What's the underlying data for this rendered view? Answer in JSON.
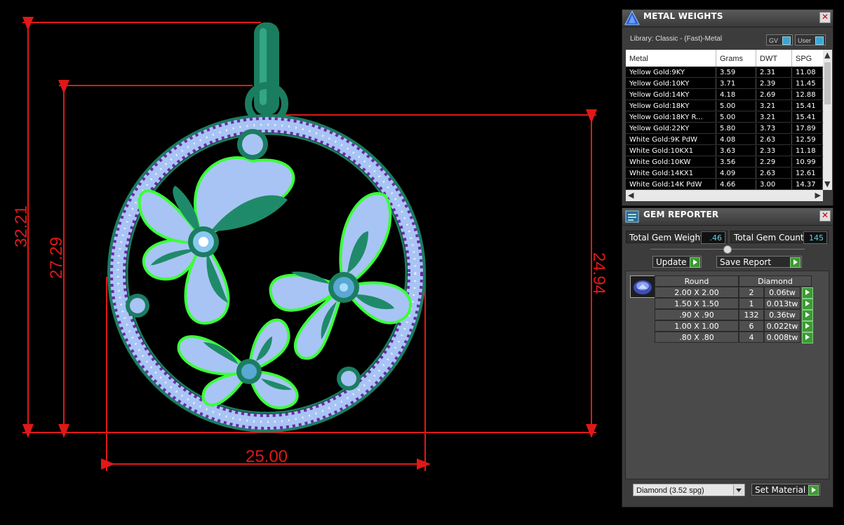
{
  "viewport": {
    "dimensions": {
      "overall_height": "32.21",
      "inner_height": "27.29",
      "ring_height": "24.94",
      "width": "25.00"
    },
    "colors": {
      "dimension": "#e01818",
      "metal": "#1f8a6a",
      "gem": "#a8c4f4",
      "accent_gem": "#6a2aa8",
      "highlight": "#3cff3c"
    }
  },
  "metal_weights": {
    "title": "METAL WEIGHTS",
    "library_label": "Library: Classic - (Fast)-Metal",
    "toggle_gv": "GV",
    "toggle_user": "User",
    "columns": [
      "Metal",
      "Grams",
      "DWT",
      "SPG"
    ],
    "rows": [
      [
        "Yellow Gold:9KY",
        "3.59",
        "2.31",
        "11.08"
      ],
      [
        "Yellow Gold:10KY",
        "3.71",
        "2.39",
        "11.45"
      ],
      [
        "Yellow Gold:14KY",
        "4.18",
        "2.69",
        "12.88"
      ],
      [
        "Yellow Gold:18KY",
        "5.00",
        "3.21",
        "15.41"
      ],
      [
        "Yellow Gold:18KY R...",
        "5.00",
        "3.21",
        "15.41"
      ],
      [
        "Yellow Gold:22KY",
        "5.80",
        "3.73",
        "17.89"
      ],
      [
        "White Gold:9K PdW",
        "4.08",
        "2.63",
        "12.59"
      ],
      [
        "White Gold:10KX1",
        "3.63",
        "2.33",
        "11.18"
      ],
      [
        "White Gold:10KW",
        "3.56",
        "2.29",
        "10.99"
      ],
      [
        "White Gold:14KX1",
        "4.09",
        "2.63",
        "12.61"
      ],
      [
        "White Gold:14K PdW",
        "4.66",
        "3.00",
        "14.37"
      ]
    ]
  },
  "gem_reporter": {
    "title": "GEM REPORTER",
    "total_weight_label": "Total Gem Weight",
    "total_weight_value": ".46",
    "total_count_label": "Total Gem Count",
    "total_count_value": "145",
    "update_label": "Update",
    "save_report_label": "Save Report",
    "shape_header": "Round",
    "material_header": "Diamond",
    "rows": [
      {
        "size": "2.00 X 2.00",
        "count": "2",
        "tw": "0.06tw"
      },
      {
        "size": "1.50 X 1.50",
        "count": "1",
        "tw": "0.013tw"
      },
      {
        "size": ".90 X .90",
        "count": "132",
        "tw": "0.36tw"
      },
      {
        "size": "1.00 X 1.00",
        "count": "6",
        "tw": "0.022tw"
      },
      {
        "size": ".80 X .80",
        "count": "4",
        "tw": "0.008tw"
      }
    ],
    "material_select": "Diamond     (3.52 spg)",
    "set_material_label": "Set Material"
  }
}
